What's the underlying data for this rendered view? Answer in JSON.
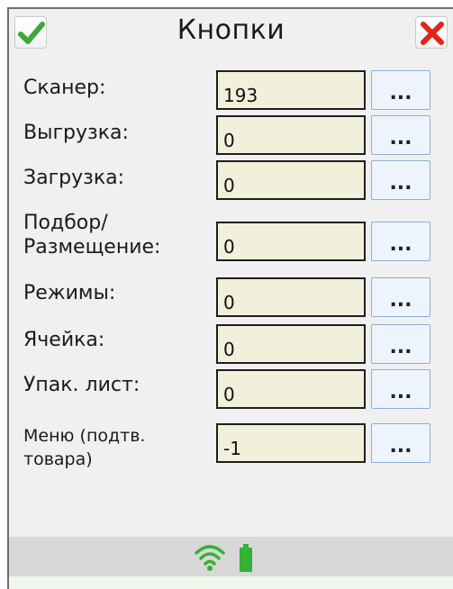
{
  "header": {
    "title": "Кнопки",
    "ok_icon": "checkmark-icon",
    "close_icon": "close-x-icon",
    "ok_color": "#3fa73a",
    "close_color": "#e0251b"
  },
  "rows": [
    {
      "label": "Сканер:",
      "value": "193",
      "button": "..."
    },
    {
      "label": "Выгрузка:",
      "value": "0",
      "button": "..."
    },
    {
      "label": "Загрузка:",
      "value": "0",
      "button": "..."
    },
    {
      "label_line1": "Подбор/",
      "label_line2": "Размещение:",
      "value": "0",
      "button": "..."
    },
    {
      "label": "Режимы:",
      "value": "0",
      "button": "..."
    },
    {
      "label": "Ячейка:",
      "value": "0",
      "button": "..."
    },
    {
      "label": "Упак. лист:",
      "value": "0",
      "button": "..."
    },
    {
      "label_line1": "Меню  (подтв.",
      "label_line2": "товара)",
      "value": "-1",
      "button": "..."
    }
  ],
  "status": {
    "wifi_icon": "wifi-icon",
    "battery_icon": "battery-icon",
    "icon_color": "#34b233"
  }
}
